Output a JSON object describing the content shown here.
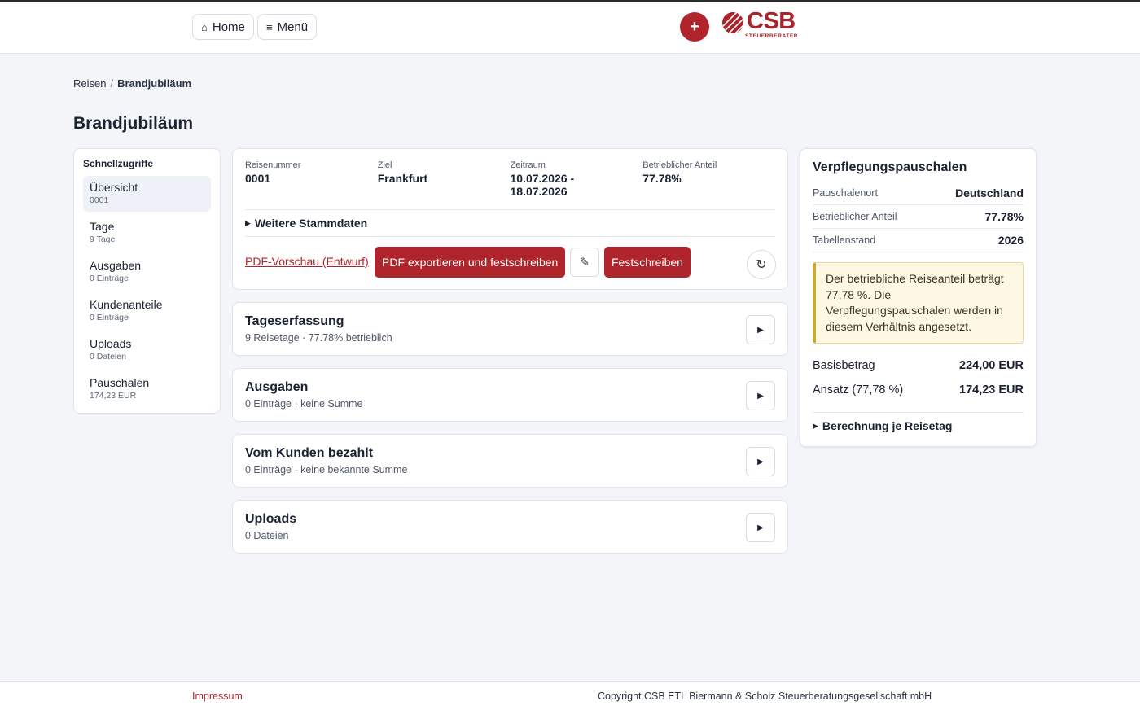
{
  "topbar": {
    "home_icon": "home-icon",
    "home_glyph": "⌂",
    "home_label": "Home",
    "menu_icon": "menu-icon",
    "menu_glyph": "≡",
    "menu_label": "Menü",
    "add_glyph": "+",
    "logo": {
      "word": "CSB",
      "sub": "STEUERBERATER"
    }
  },
  "breadcrumb": {
    "root": "Reisen",
    "sep": "/",
    "current": "Brandjubiläum"
  },
  "page_title": "Brandjubiläum",
  "sidebar": {
    "heading": "Schnellzugriffe",
    "items": [
      {
        "label": "Übersicht",
        "sub": "0001"
      },
      {
        "label": "Tage",
        "sub": "9 Tage"
      },
      {
        "label": "Ausgaben",
        "sub": "0 Einträge"
      },
      {
        "label": "Kundenanteile",
        "sub": "0 Einträge"
      },
      {
        "label": "Uploads",
        "sub": "0 Dateien"
      },
      {
        "label": "Pauschalen",
        "sub": "174,23 EUR"
      }
    ]
  },
  "trip": {
    "meta": [
      {
        "key": "Reisenummer",
        "value": "0001"
      },
      {
        "key": "Ziel",
        "value": "Frankfurt"
      },
      {
        "key": "Zeitraum",
        "value": "10.07.2026 - 18.07.2026"
      },
      {
        "key": "Betrieblicher Anteil",
        "value": "77.78%"
      }
    ],
    "more_label": "Weitere Stammdaten",
    "pdf_preview": "PDF-Vorschau (Entwurf)",
    "pdf_export": "PDF exportieren und festschreiben",
    "edit_glyph": "✎",
    "finalize": "Festschreiben",
    "refresh_glyph": "↻"
  },
  "sections": [
    {
      "title": "Tageserfassung",
      "sub": "9 Reisetage · 77.78% betrieblich"
    },
    {
      "title": "Ausgaben",
      "sub": "0 Einträge · keine Summe"
    },
    {
      "title": "Vom Kunden bezahlt",
      "sub": "0 Einträge · keine bekannte Summe"
    },
    {
      "title": "Uploads",
      "sub": "0 Dateien"
    }
  ],
  "chevron_glyph": "▶",
  "panel": {
    "title": "Verpflegungspauschalen",
    "rows": [
      {
        "key": "Pauschalenort",
        "value": "Deutschland"
      },
      {
        "key": "Betrieblicher Anteil",
        "value": "77.78%"
      },
      {
        "key": "Tabellenstand",
        "value": "2026"
      }
    ],
    "note": "Der betriebliche Reiseanteil beträgt 77,78 %. Die Verpflegungspauschalen werden in diesem Verhältnis angesetzt.",
    "base_label": "Basisbetrag",
    "base_value": "224,00 EUR",
    "rate_label": "Ansatz (77,78 %)",
    "rate_value": "174,23 EUR",
    "more_label": "Berechnung je Reisetag"
  },
  "footer": {
    "impressum": "Impressum",
    "copyright": "Copyright CSB ETL Biermann & Scholz Steuerberatungsgesellschaft mbH"
  },
  "colors": {
    "brand": "#b0252c",
    "background": "#f3f5f9"
  }
}
